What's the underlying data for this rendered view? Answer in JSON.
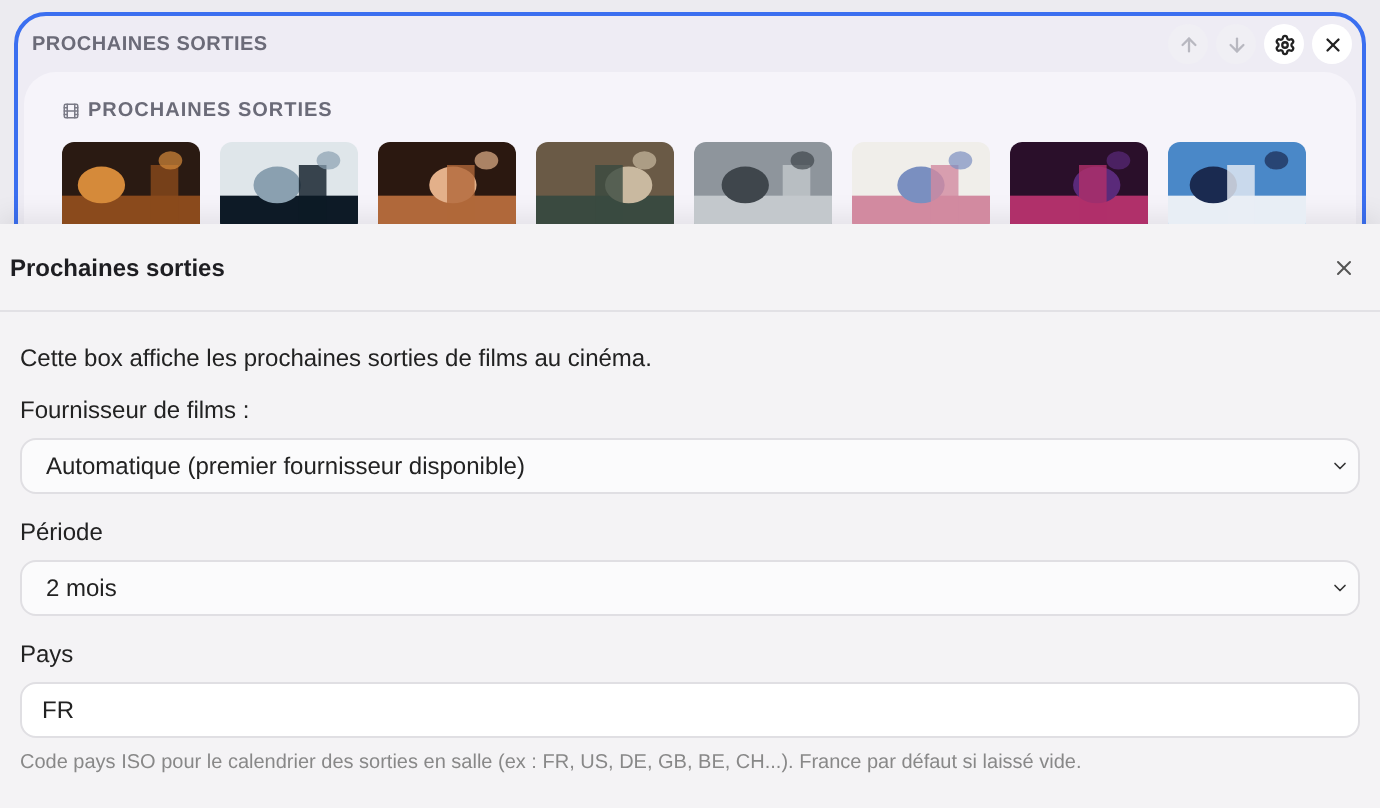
{
  "widget": {
    "title": "PROCHAINES SORTIES",
    "actions": [
      {
        "kind": "up",
        "disabled": true
      },
      {
        "kind": "down",
        "disabled": true
      },
      {
        "kind": "settings",
        "disabled": false
      },
      {
        "kind": "close",
        "disabled": false
      }
    ],
    "card": {
      "title": "PROCHAINES SORTIES"
    }
  },
  "dialog": {
    "title": "Prochaines sorties",
    "description": "Cette box affiche les prochaines sorties de films au cinéma.",
    "fields": [
      {
        "kind": "select",
        "label": "Fournisseur de films :",
        "value": "Automatique (premier fournisseur disponible)"
      },
      {
        "kind": "select",
        "label": "Période",
        "value": "2 mois"
      },
      {
        "kind": "text",
        "label": "Pays",
        "value": "FR",
        "help": "Code pays ISO pour le calendrier des sorties en salle (ex : FR, US, DE, GB, BE, CH...). France par défaut si laissé vide."
      }
    ]
  }
}
